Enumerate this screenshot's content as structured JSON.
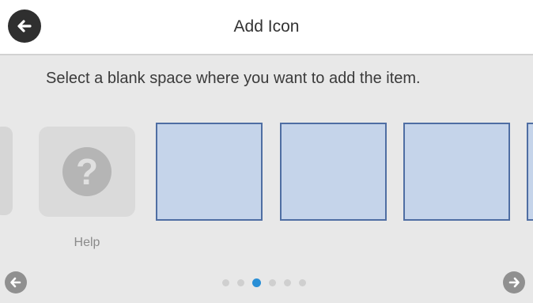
{
  "header": {
    "title": "Add Icon",
    "back_icon": "arrow-left-icon"
  },
  "instruction": "Select a blank space where you want to add the item.",
  "help_item": {
    "label": "Help",
    "icon": "question-mark-icon",
    "glyph": "?"
  },
  "slots": [
    {
      "state": "blank"
    },
    {
      "state": "blank"
    },
    {
      "state": "blank"
    },
    {
      "state": "blank"
    }
  ],
  "pagination": {
    "total": 6,
    "current": 3
  },
  "nav": {
    "prev_icon": "arrow-left-icon",
    "next_icon": "arrow-right-icon"
  },
  "colors": {
    "slot_fill": "#c5d4ea",
    "slot_border": "#4f6ea3",
    "active_dot": "#2a8fd6"
  }
}
